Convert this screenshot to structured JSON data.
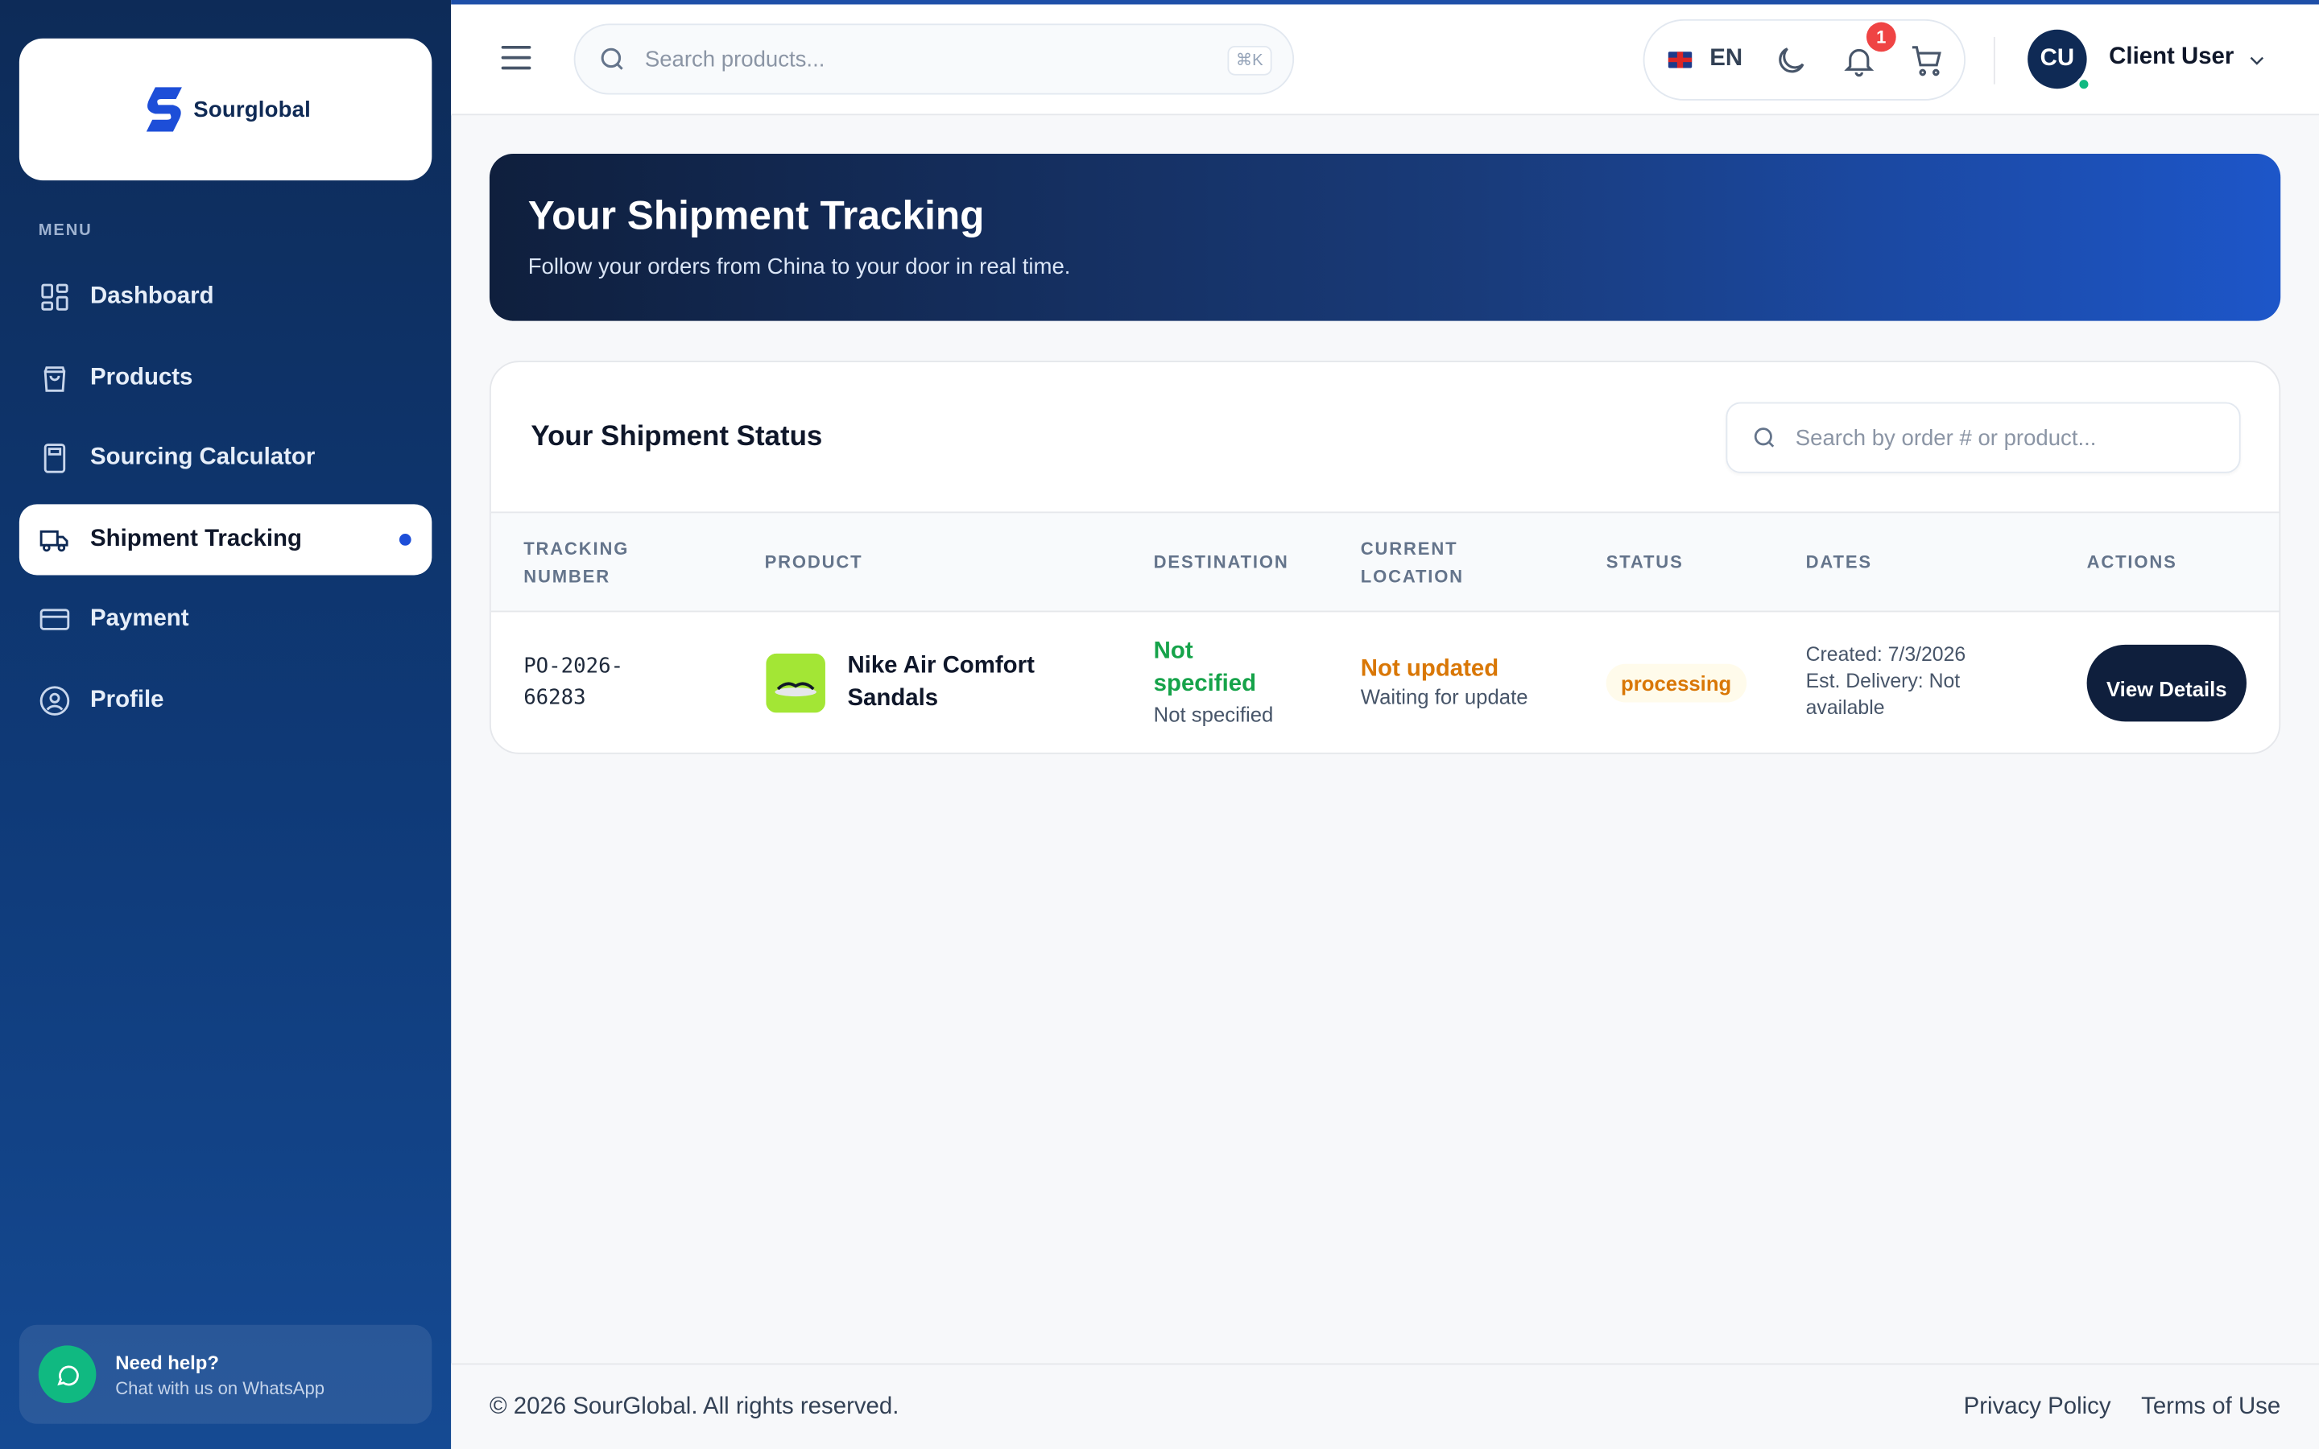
{
  "brand": {
    "name": "Sourglobal"
  },
  "sidebar": {
    "menu_label": "MENU",
    "items": [
      {
        "label": "Dashboard",
        "icon": "dashboard-icon"
      },
      {
        "label": "Products",
        "icon": "shopping-bag-icon"
      },
      {
        "label": "Sourcing Calculator",
        "icon": "calculator-icon"
      },
      {
        "label": "Shipment Tracking",
        "icon": "truck-icon",
        "active": true
      },
      {
        "label": "Payment",
        "icon": "credit-card-icon"
      },
      {
        "label": "Profile",
        "icon": "user-circle-icon"
      }
    ],
    "help": {
      "title": "Need help?",
      "subtitle": "Chat with us on WhatsApp"
    }
  },
  "topbar": {
    "search_placeholder": "Search products...",
    "shortcut": "⌘K",
    "language": "EN",
    "notification_count": "1",
    "user_initials": "CU",
    "user_name": "Client User"
  },
  "hero": {
    "title": "Your Shipment Tracking",
    "subtitle": "Follow your orders from China to your door in real time."
  },
  "shipments": {
    "title": "Your Shipment Status",
    "search_placeholder": "Search by order # or product...",
    "columns": [
      "TRACKING NUMBER",
      "PRODUCT",
      "DESTINATION",
      "CURRENT LOCATION",
      "STATUS",
      "DATES",
      "ACTIONS"
    ],
    "rows": [
      {
        "tracking": "PO-2026-66283",
        "product": "Nike Air Comfort Sandals",
        "destination": "Not specified",
        "destination_sub": "Not specified",
        "location": "Not updated",
        "location_sub": "Waiting for update",
        "status": "processing",
        "created": "Created: 7/3/2026",
        "delivery": "Est. Delivery: Not available",
        "action": "View Details"
      }
    ]
  },
  "footer": {
    "copyright": "© 2026 SourGlobal. All rights reserved.",
    "privacy": "Privacy Policy",
    "terms": "Terms of Use"
  },
  "colors": {
    "sidebar": "#0f3a78",
    "accent": "#1d4ed8",
    "success": "#16a34a",
    "warning": "#d97706",
    "badge": "#ef4444"
  }
}
